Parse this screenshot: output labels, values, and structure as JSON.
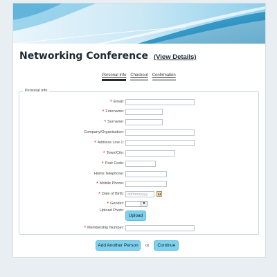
{
  "page": {
    "title": "Networking Conference",
    "view_details": "(View Details)"
  },
  "steps": [
    "Personal Info",
    "Checkout",
    "Confirmation"
  ],
  "form": {
    "legend": "Personal Info",
    "fields": {
      "email": "Email:",
      "forename": "Forename:",
      "surname": "Surname:",
      "company": "Company/Organisation:",
      "address1": "Address Line 1:",
      "town": "Town/City:",
      "postcode": "Post Code:",
      "home_tel": "Home Telephone:",
      "mobile": "Mobile Phone:",
      "dob": "Date of Birth:",
      "gender": "Gender:",
      "upload_photo": "Upload Photo:",
      "membership": "Membership Number:"
    },
    "dob_placeholder": "dd/mm/yyyy",
    "required_marker": "*",
    "gender_arrow": "▼",
    "upload_button": "Upload"
  },
  "actions": {
    "add_another": "Add Another Person",
    "or": "or",
    "continue": "Continue"
  },
  "colors": {
    "button": "#7fd1ec",
    "required": "#dd0000",
    "banner_dark": "#1f86b6",
    "banner_light": "#cfeaf6"
  }
}
